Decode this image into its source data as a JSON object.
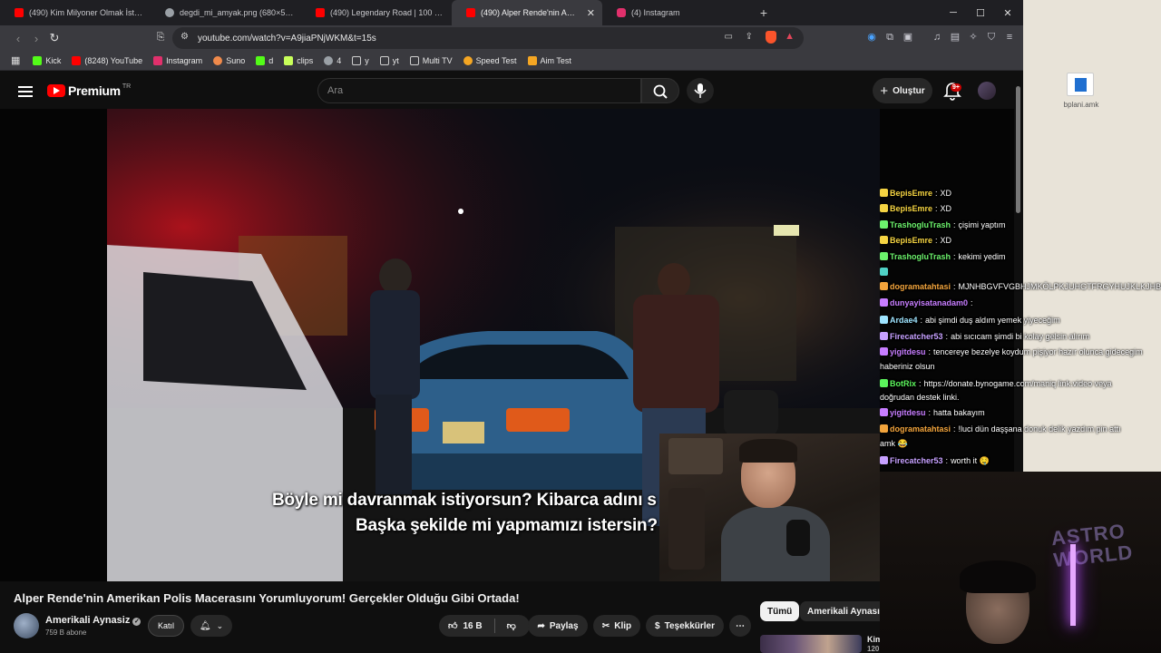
{
  "browser": {
    "tabs": [
      {
        "title": "(490) Kim Milyoner Olmak İster? 120",
        "favicon": "youtube-icon",
        "color": "#ff0000",
        "active": false
      },
      {
        "title": "degdi_mi_amyak.png (680×580)",
        "favicon": "globe-icon",
        "color": "#9aa0a6",
        "active": false
      },
      {
        "title": "(490) Legendary Road | 100 km/h - Y",
        "favicon": "youtube-icon",
        "color": "#ff0000",
        "active": false
      },
      {
        "title": "(490) Alper Rende'nin Amerik",
        "favicon": "youtube-icon",
        "color": "#ff0000",
        "active": true
      },
      {
        "title": "(4) Instagram",
        "favicon": "instagram-icon",
        "color": "#e1306c",
        "active": false
      }
    ],
    "new_tab": "+",
    "url": "youtube.com/watch?v=A9jiaPNjWKM&t=15s",
    "bookmarks": [
      {
        "label": "Kick",
        "color": "#53fc18"
      },
      {
        "label": "(8248) YouTube",
        "color": "#ff0000"
      },
      {
        "label": "Instagram",
        "color": "#e1306c"
      },
      {
        "label": "Suno",
        "color": "#f08a4b"
      },
      {
        "label": "d",
        "color": "#53fc18"
      },
      {
        "label": "clips",
        "color": "#c8ff5a"
      },
      {
        "label": "4",
        "color": "#9aa0a6"
      },
      {
        "label": "y",
        "color": "#9aa0a6"
      },
      {
        "label": "yt",
        "color": "#9aa0a6"
      },
      {
        "label": "Multi TV",
        "color": "#9aa0a6"
      },
      {
        "label": "Speed Test",
        "color": "#f5a623"
      },
      {
        "label": "Aim Test",
        "color": "#f5a623"
      }
    ]
  },
  "youtube": {
    "logo_text": "Premium",
    "region": "TR",
    "search_placeholder": "Ara",
    "create_label": "Oluştur",
    "notif_count": "9+",
    "video": {
      "subtitle_line1": "Böyle mi davranmak istiyorsun? Kibarca adını s",
      "subtitle_line2": "Başka şekilde mi yapmamızı istersin?"
    },
    "title": "Alper Rende'nin Amerikan Polis Macerasını Yorumluyorum! Gerçekler Olduğu Gibi Ortada!",
    "channel": {
      "name": "Amerikali Aynasiz",
      "subs": "759 B abone"
    },
    "join_label": "Katıl",
    "like_count": "16 B",
    "share_label": "Paylaş",
    "clip_label": "Klip",
    "thanks_label": "Teşekkürler",
    "more_label": "⋯",
    "chips": [
      "Tümü",
      "Amerikali Aynasız"
    ],
    "rec_title": "Kim",
    "rec_sub": "120"
  },
  "desktop": {
    "icon_label": "bplani.amk"
  },
  "chat": [
    {
      "user": "BepisEmre",
      "color": "#f5d442",
      "text": "XD"
    },
    {
      "user": "BepisEmre",
      "color": "#f5d442",
      "text": "XD"
    },
    {
      "user": "TrashogluTrash",
      "color": "#6cf26c",
      "text": "çişimi yaptım"
    },
    {
      "user": "BepisEmre",
      "color": "#f5d442",
      "text": "XD"
    },
    {
      "user": "TrashogluTrash",
      "color": "#6cf26c",
      "text": "kekimi yedim"
    },
    {
      "user": "",
      "color": "#ffffff",
      "text": ""
    },
    {
      "user": "dogramatahtasi",
      "color": "#f2a43c",
      "text": "MJNHBGVFVGBHJMKÖLPKJUHGTFRGYHUJKLKJHBGV"
    },
    {
      "user": "dunyayisatanadam0",
      "color": "#c77dff",
      "text": ""
    },
    {
      "user": "Ardae4",
      "color": "#9ee4ff",
      "text": "abi şimdi duş aldım yemek yiyeceğim"
    },
    {
      "user": "Firecatcher53",
      "color": "#c6a0ff",
      "text": "abi sıcıcam şimdi bi kolay gelsin alırım"
    },
    {
      "user": "yigitdesu",
      "color": "#c77dff",
      "text": "tencereye bezelye koydum pişiyor hazır olunca gidecegim"
    },
    {
      "user": "",
      "color": "#ffffff",
      "text": "haberiniz olsun"
    },
    {
      "user": "BotRix",
      "color": "#5cf55c",
      "text": "https://donate.bynogame.com/maniq link.video veya"
    },
    {
      "user": "",
      "color": "#ffffff",
      "text": "doğrudan destek linki."
    },
    {
      "user": "yigitdesu",
      "color": "#c77dff",
      "text": "hatta bakayım"
    },
    {
      "user": "dogramatahtasi",
      "color": "#f2a43c",
      "text": "!luci dün daşşana donuk delik yazdım pin attı"
    },
    {
      "user": "",
      "color": "#ffffff",
      "text": "amk 😂"
    },
    {
      "user": "Firecatcher53",
      "color": "#c6a0ff",
      "text": "worth it 🤤"
    }
  ],
  "streamer_sign": "ASTRO WORLD"
}
